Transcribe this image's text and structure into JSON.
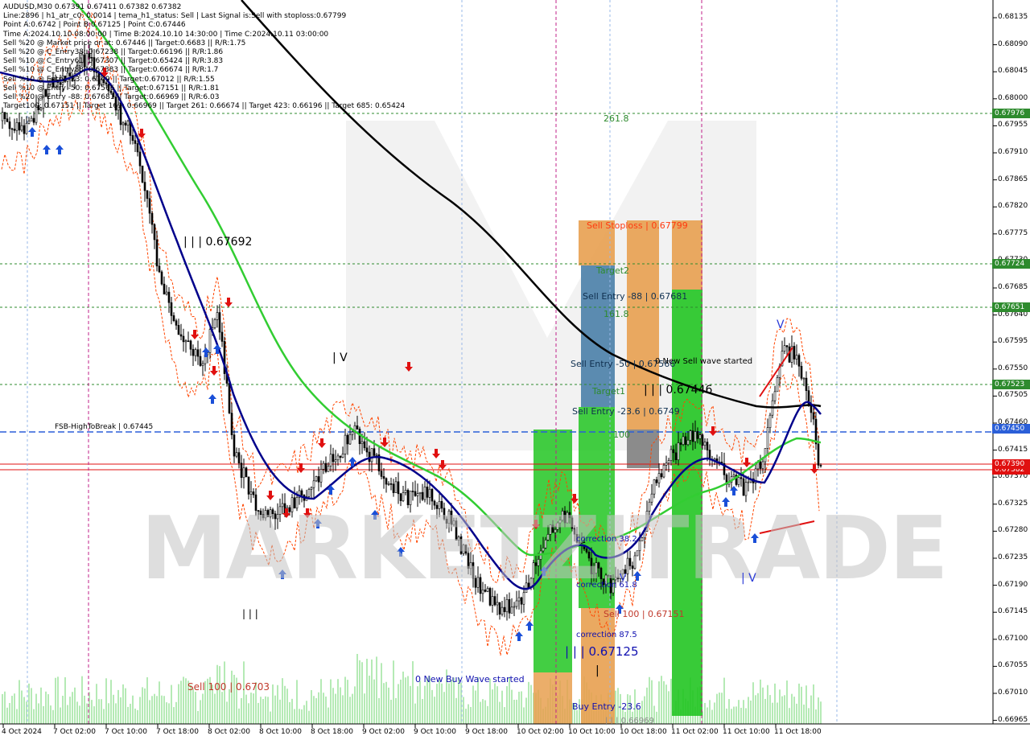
{
  "info_lines": [
    "AUDUSD,M30  0.67391 0.67411 0.67382 0.67382",
    "Line:2896 | h1_atr_c0: 0.0014 | tema_h1_status: Sell | Last Signal is:Sell with stoploss:0.67799",
    "Point A:0.6742 | Point B:0.67125 | Point C:0.67446",
    "Time A:2024.10.10 08:00:00 | Time B:2024.10.10 14:30:00 | Time C:2024.10.11 03:00:00",
    "Sell %20 @ Market price or at: 0.67446 || Target:0.6683 || R/R:1.75",
    "Sell %20 @ C_Entry38: 0.67238 || Target:0.66196 || R/R:1.86",
    "Sell %10 @ C_Entry61: 0.67307 || Target:0.65424 || R/R:3.83",
    "Sell %10 @ C_Entry88: 0.67383 || Target:0.66674 || R/R:1.7",
    "Sell %10 @ Entry -23: 0.6749 || Target:0.67012 || R/R:1.55",
    "Sell %10 @ Entry -50: 0.67566 || Target:0.67151 || R/R:1.81",
    "Sell %20 @ Entry -88: 0.67681 || Target:0.66969 || R/R:6.03",
    "Target100: 0.67151 || Target 161: 0.66969 || Target 261: 0.66674 || Target 423: 0.66196 || Target 685: 0.65424"
  ],
  "watermark": "MARKETZITRADE",
  "price_axis": {
    "ticks": [
      "0.68135",
      "0.68090",
      "0.68045",
      "0.68000",
      "0.67955",
      "0.67910",
      "0.67865",
      "0.67820",
      "0.67775",
      "0.67730",
      "0.67685",
      "0.67640",
      "0.67595",
      "0.67550",
      "0.67505",
      "0.67460",
      "0.67415",
      "0.67370",
      "0.67325",
      "0.67280",
      "0.67235",
      "0.67190",
      "0.67145",
      "0.67100",
      "0.67055",
      "0.67010",
      "0.66965"
    ],
    "tags": [
      {
        "text": "0.67976",
        "color": "#2e8b2e"
      },
      {
        "text": "0.67724",
        "color": "#2e8b2e"
      },
      {
        "text": "0.67651",
        "color": "#2e8b2e"
      },
      {
        "text": "0.67523",
        "color": "#2e8b2e"
      },
      {
        "text": "0.67450",
        "color": "#2b5fd8"
      },
      {
        "text": "0.67382",
        "color": "#e01010"
      },
      {
        "text": "0.67390",
        "color": "#e01010"
      }
    ]
  },
  "time_axis": [
    "4 Oct 2024",
    "7 Oct 02:00",
    "7 Oct 10:00",
    "7 Oct 18:00",
    "8 Oct 02:00",
    "8 Oct 10:00",
    "8 Oct 18:00",
    "9 Oct 02:00",
    "9 Oct 10:00",
    "9 Oct 18:00",
    "10 Oct 02:00",
    "10 Oct 10:00",
    "10 Oct 18:00",
    "11 Oct 02:00",
    "11 Oct 10:00",
    "11 Oct 18:00"
  ],
  "labels": {
    "l261": "261.8",
    "l67692": "| | | 0.67692",
    "l_iv1": "| V",
    "l_iii1": "| | |",
    "fsb": "FSB-HighToBreak | 0.67445",
    "sell100_left": "Sell 100 | 0.6703",
    "new_buy": "0 New Buy Wave started",
    "sell_stoploss": "Sell Stoploss | 0.67799",
    "target2": "Target2",
    "sell_entry88": "Sell Entry -88 | 0.67681",
    "l161": "161.8",
    "sell_entry50": "Sell Entry -50 | 0.67566",
    "new_sell": "0 New Sell wave started",
    "target1": "Target1",
    "iii_67446": "| | | 0.67446",
    "sell_entry236": "Sell Entry -23.6 | 0.6749",
    "l100": "100",
    "correction382": "correction 38.2",
    "correction618": "correction 61.8",
    "sell100_mid": "Sell 100 | 0.67151",
    "correction875": "correction 87.5",
    "iii_67125": "| | | 0.67125",
    "l_i": "|",
    "buy_entry": "Buy Entry -23.6",
    "buy_entry_val": "| | | 0.66969",
    "l_v": "V",
    "l_iv2": "| V",
    "l_v_small": "V",
    "l_iv_bot": "| V"
  },
  "colors": {
    "bull_candle": "#000000",
    "ema_slow": "#000000",
    "ema_mid": "#00008b",
    "ema_fast": "#32cd32",
    "bands": "#ff4500",
    "green_zone": "#22c522",
    "orange_zone": "#e8a050",
    "blue_zone": "#4a7fa8",
    "grey_zone": "#808080",
    "volume": "#5ad05a"
  }
}
